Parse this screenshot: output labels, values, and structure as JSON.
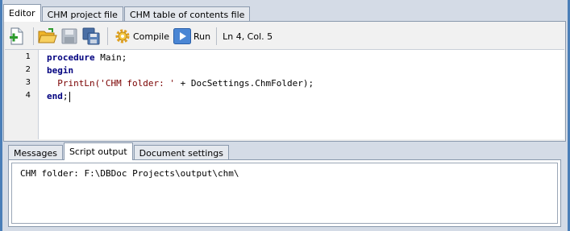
{
  "top_tabs": [
    "Editor",
    "CHM project file",
    "CHM table of contents file"
  ],
  "toolbar": {
    "compile_label": "Compile",
    "run_label": "Run",
    "cursor_status": "Ln 4, Col. 5"
  },
  "code": {
    "line_numbers": [
      "1",
      "2",
      "3",
      "4"
    ],
    "lines": {
      "l1_kw": "procedure",
      "l1_rest": " Main;",
      "l2_kw": "begin",
      "l3_indent": "  ",
      "l3_fn": "PrintLn(",
      "l3_str": "'CHM folder: '",
      "l3_rest": " + DocSettings.ChmFolder);",
      "l4_kw": "end",
      "l4_rest": ";"
    }
  },
  "bottom_tabs": [
    "Messages",
    "Script output",
    "Document settings"
  ],
  "output": {
    "text": "CHM folder: F:\\DBDoc Projects\\output\\chm\\"
  },
  "colors": {
    "keyword": "#00007f",
    "string": "#7a0000",
    "frame": "#4a7eb8"
  }
}
